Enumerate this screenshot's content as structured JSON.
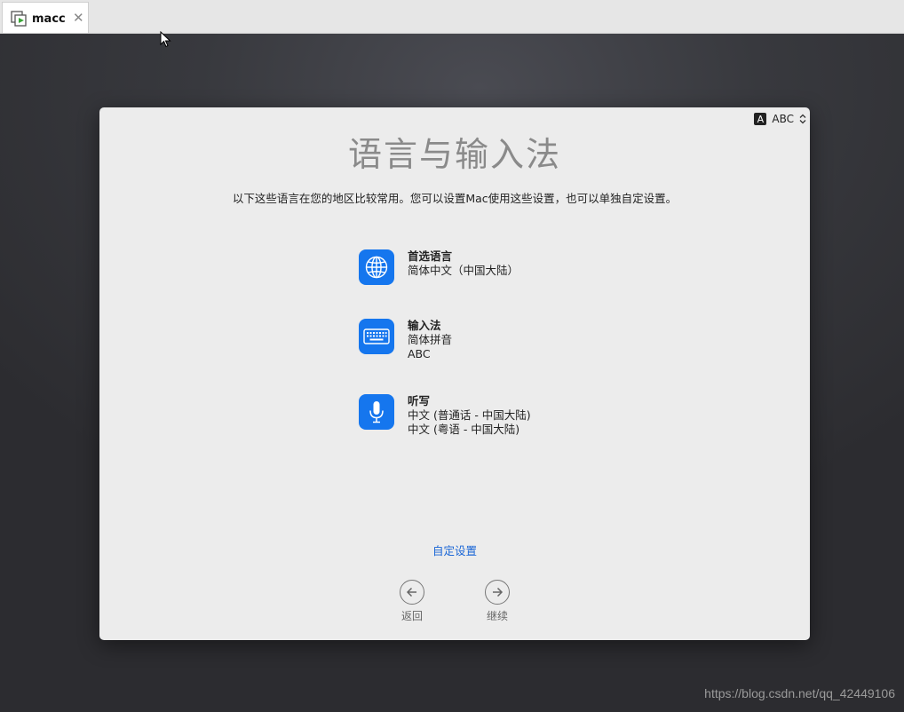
{
  "tab": {
    "title": "macc",
    "close_glyph": "✕",
    "icon": "vm-player-icon"
  },
  "input_menu": {
    "badge": "A",
    "label": "ABC",
    "icon": "chevron-updown-icon"
  },
  "dialog": {
    "title": "语言与输入法",
    "subtitle": "以下这些语言在您的地区比较常用。您可以设置Mac使用这些设置，也可以单独自定设置。",
    "items": [
      {
        "icon": "globe-icon",
        "label": "首选语言",
        "values": [
          "简体中文（中国大陆）"
        ]
      },
      {
        "icon": "keyboard-icon",
        "label": "输入法",
        "values": [
          "简体拼音",
          "ABC"
        ]
      },
      {
        "icon": "microphone-icon",
        "label": "听写",
        "values": [
          "中文 (普通话 - 中国大陆)",
          "中文 (粤语 - 中国大陆)"
        ]
      }
    ],
    "custom_link": "自定设置",
    "back_label": "返回",
    "continue_label": "继续"
  },
  "watermark": "https://blog.csdn.net/qq_42449106",
  "colors": {
    "accent": "#1576ee",
    "link": "#1a66d6",
    "panel": "#ececec"
  }
}
